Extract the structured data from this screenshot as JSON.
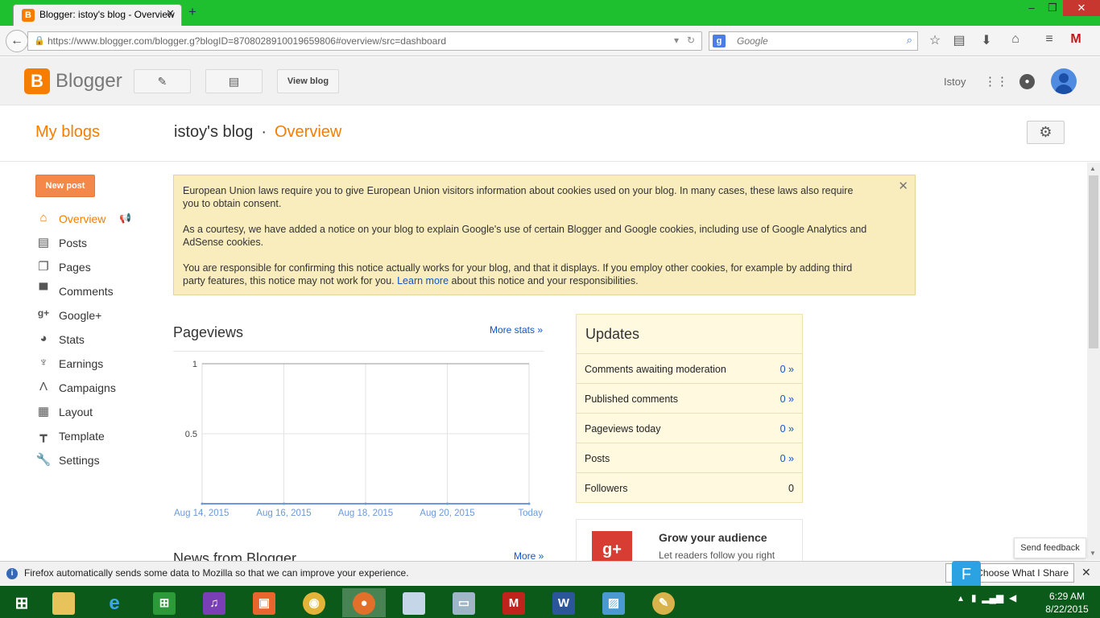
{
  "browser": {
    "tab_title": "Blogger: istoy's blog - Overview",
    "new_tab": "+",
    "url_host": "https://www.blogger.com",
    "url_path": "/blogger.g?blogID=870802891001965980​6#overview/src=dashboard",
    "search_placeholder": "Google",
    "window_controls": {
      "minimize": "–",
      "maximize": "❐",
      "close": "✕"
    }
  },
  "header": {
    "brand": "Blogger",
    "view_blog": "View blog",
    "user": "Istoy"
  },
  "page": {
    "my_blogs": "My blogs",
    "blog_name": "istoy's blog",
    "separator": "·",
    "section": "Overview"
  },
  "sidebar": {
    "new_post": "New post",
    "items": [
      {
        "label": "Overview",
        "icon": "home-icon"
      },
      {
        "label": "Posts",
        "icon": "posts-icon"
      },
      {
        "label": "Pages",
        "icon": "pages-icon"
      },
      {
        "label": "Comments",
        "icon": "comments-icon"
      },
      {
        "label": "Google+",
        "icon": "google-plus-icon"
      },
      {
        "label": "Stats",
        "icon": "stats-icon"
      },
      {
        "label": "Earnings",
        "icon": "trophy-icon"
      },
      {
        "label": "Campaigns",
        "icon": "campaigns-icon"
      },
      {
        "label": "Layout",
        "icon": "layout-icon"
      },
      {
        "label": "Template",
        "icon": "template-icon"
      },
      {
        "label": "Settings",
        "icon": "wrench-icon"
      }
    ]
  },
  "notice": {
    "p1": "European Union laws require you to give European Union visitors information about cookies used on your blog. In many cases, these laws also require you to obtain consent.",
    "p2": "As a courtesy, we have added a notice on your blog to explain Google's use of certain Blogger and Google cookies, including use of Google Analytics and AdSense cookies.",
    "p3_before": "You are responsible for confirming this notice actually works for your blog, and that it displays. If you employ other cookies, for example by adding third party features, this notice may not work for you.",
    "p3_link": "Learn more",
    "p3_after": "about this notice and your responsibilities."
  },
  "pageviews": {
    "title": "Pageviews",
    "more_stats": "More stats »"
  },
  "chart_data": {
    "type": "line",
    "x": [
      "Aug 14, 2015",
      "Aug 16, 2015",
      "Aug 18, 2015",
      "Aug 20, 2015",
      "Today"
    ],
    "values": [
      0,
      0,
      0,
      0,
      0
    ],
    "yticks": [
      "1",
      "0.5"
    ],
    "ylim": [
      0,
      1
    ],
    "grid": true
  },
  "updates": {
    "title": "Updates",
    "rows": [
      {
        "label": "Comments awaiting moderation",
        "value": "0 »"
      },
      {
        "label": "Published comments",
        "value": "0 »"
      },
      {
        "label": "Pageviews today",
        "value": "0 »"
      },
      {
        "label": "Posts",
        "value": "0 »"
      },
      {
        "label": "Followers",
        "value": "0"
      }
    ]
  },
  "grow": {
    "title": "Grow your audience",
    "subtitle": "Let readers follow you right"
  },
  "news": {
    "title": "News from Blogger",
    "more": "More »"
  },
  "feedback": "Send feedback",
  "firefox_bar": {
    "message": "Firefox automatically sends some data to Mozilla so that we can improve your experience.",
    "choose": "Choose What I Share"
  },
  "taskbar": {
    "time": "6:29 AM",
    "date": "8/22/2015"
  }
}
